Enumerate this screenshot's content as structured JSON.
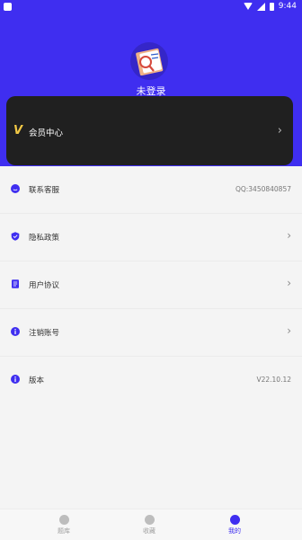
{
  "status_bar": {
    "time": "9:44"
  },
  "profile": {
    "login_text": "未登录"
  },
  "vip": {
    "label": "会员中心",
    "logo": "V"
  },
  "menu": [
    {
      "label": "联系客服",
      "value": "QQ:3450840857",
      "icon": "smile-icon"
    },
    {
      "label": "隐私政策",
      "value": "",
      "icon": "shield-check-icon",
      "chevron": "›"
    },
    {
      "label": "用户协议",
      "value": "",
      "icon": "document-icon",
      "chevron": "›"
    },
    {
      "label": "注销账号",
      "value": "",
      "icon": "info-icon",
      "chevron": "›"
    },
    {
      "label": "版本",
      "value": "V22.10.12",
      "icon": "info-icon"
    }
  ],
  "tabs": [
    {
      "label": "题库",
      "icon": "book-icon"
    },
    {
      "label": "收藏",
      "icon": "star-icon"
    },
    {
      "label": "我的",
      "icon": "person-icon",
      "active": true
    }
  ],
  "colors": {
    "accent": "#3f2ef0",
    "vip_bg": "#202020",
    "vip_gold": "#f1c845"
  }
}
